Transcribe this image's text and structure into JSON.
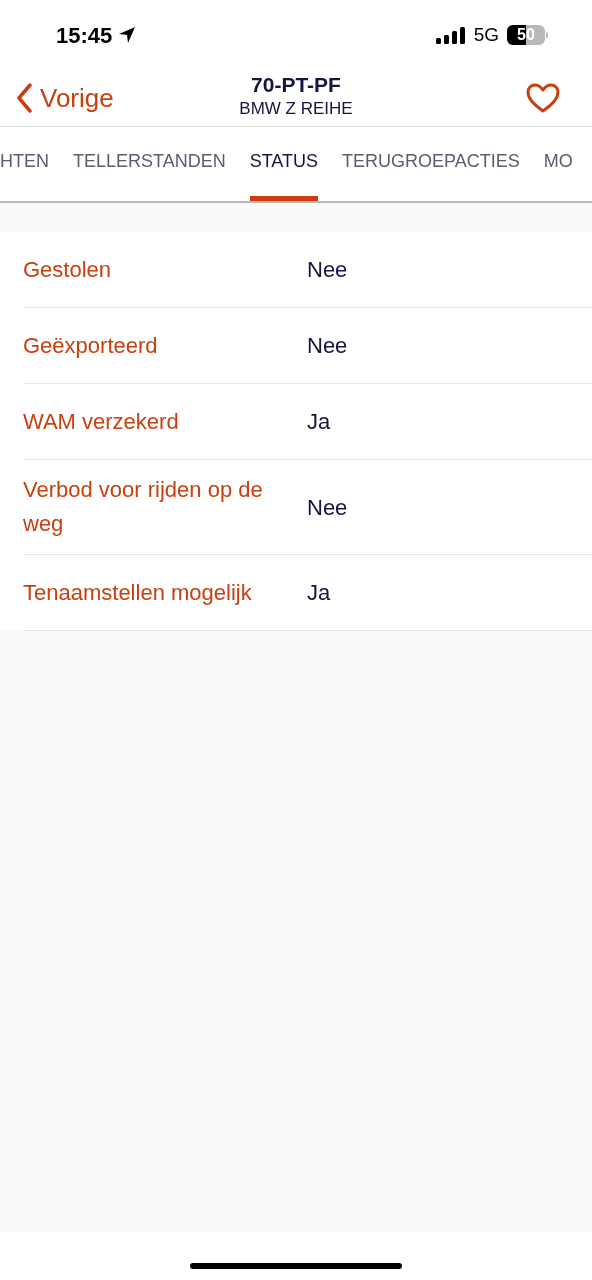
{
  "status_bar": {
    "time": "15:45",
    "network": "5G",
    "battery": "50"
  },
  "nav": {
    "back_label": "Vorige",
    "title": "70-PT-PF",
    "subtitle": "BMW Z REIHE",
    "favorite": false
  },
  "tabs": [
    {
      "label": "HTEN",
      "selected": false
    },
    {
      "label": "TELLERSTANDEN",
      "selected": false
    },
    {
      "label": "STATUS",
      "selected": true
    },
    {
      "label": "TERUGROEPACTIES",
      "selected": false
    },
    {
      "label": "MO",
      "selected": false
    }
  ],
  "rows": [
    {
      "label": "Gestolen",
      "value": "Nee"
    },
    {
      "label": "Geëxporteerd",
      "value": "Nee"
    },
    {
      "label": "WAM verzekerd",
      "value": "Ja"
    },
    {
      "label": "Verbod voor rijden op de weg",
      "value": "Nee"
    },
    {
      "label": "Tenaamstellen mogelijk",
      "value": "Ja"
    }
  ]
}
